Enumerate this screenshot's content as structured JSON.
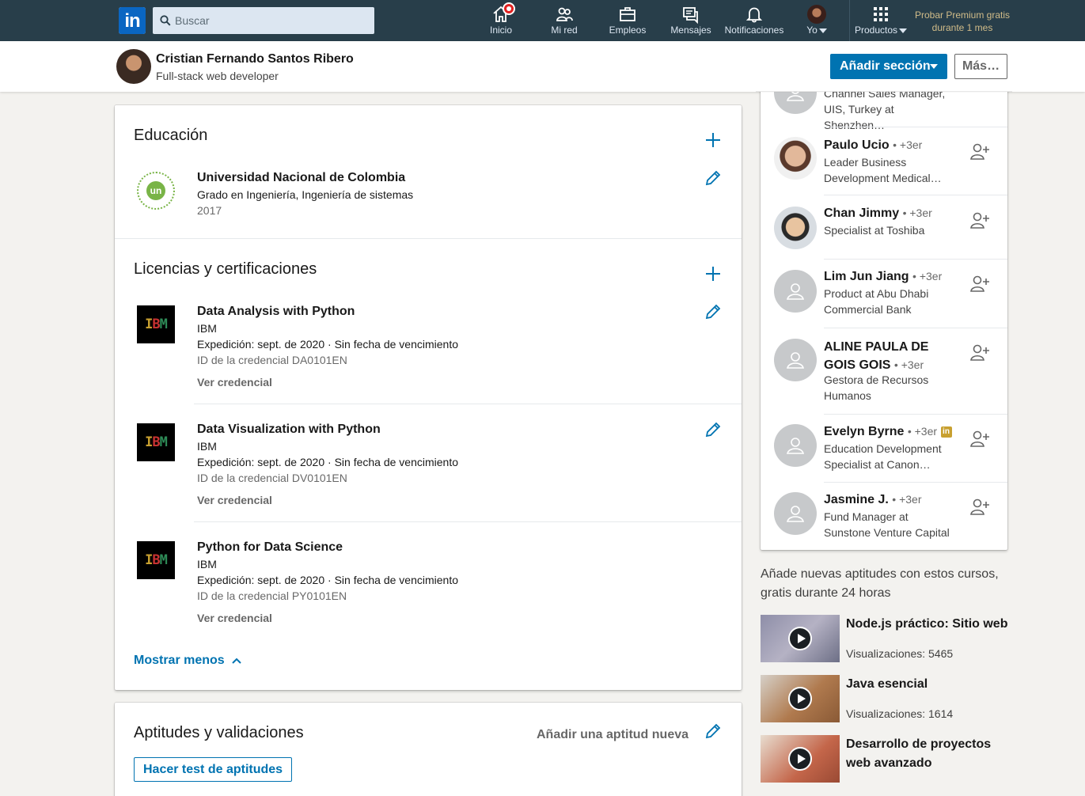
{
  "nav": {
    "logo_text": "in",
    "search_placeholder": "Buscar",
    "items": [
      {
        "label": "Inicio",
        "icon": "home-icon"
      },
      {
        "label": "Mi red",
        "icon": "network-icon"
      },
      {
        "label": "Empleos",
        "icon": "briefcase-icon"
      },
      {
        "label": "Mensajes",
        "icon": "messages-icon"
      },
      {
        "label": "Notificaciones",
        "icon": "bell-icon"
      },
      {
        "label": "Yo",
        "icon": "avatar"
      },
      {
        "label": "Productos",
        "icon": "grid-icon"
      }
    ],
    "premium_line1": "Probar Premium gratis",
    "premium_line2": "durante 1 mes"
  },
  "profile_bar": {
    "name": "Cristian Fernando Santos Ribero",
    "headline": "Full-stack web developer",
    "add_section": "Añadir sección",
    "more": "Más…"
  },
  "education": {
    "title": "Educación",
    "entry": {
      "school": "Universidad Nacional de Colombia",
      "degree": "Grado en Ingeniería, Ingeniería de sistemas",
      "year": "2017",
      "logo_text": "un"
    }
  },
  "licenses": {
    "title": "Licencias y certificaciones",
    "items": [
      {
        "name": "Data Analysis with Python",
        "issuer": "IBM",
        "issued": "Expedición: sept. de 2020",
        "expiry": "Sin fecha de vencimiento",
        "credential": "ID de la credencial DA0101EN",
        "link": "Ver credencial"
      },
      {
        "name": "Data Visualization with Python",
        "issuer": "IBM",
        "issued": "Expedición: sept. de 2020",
        "expiry": "Sin fecha de vencimiento",
        "credential": "ID de la credencial DV0101EN",
        "link": "Ver credencial"
      },
      {
        "name": "Python for Data Science",
        "issuer": "IBM",
        "issued": "Expedición: sept. de 2020",
        "expiry": "Sin fecha de vencimiento",
        "credential": "ID de la credencial PY0101EN",
        "link": "Ver credencial"
      }
    ],
    "show_less": "Mostrar menos",
    "separator": "·"
  },
  "skills": {
    "title": "Aptitudes y validaciones",
    "add_skill": "Añadir una aptitud nueva",
    "test_button": "Hacer test de aptitudes"
  },
  "people": {
    "partial_headline_1": "Channel Sales Manager,",
    "partial_headline_2": "UIS, Turkey at Shenzhen…",
    "items": [
      {
        "name": "Paulo Ucio",
        "degree": "• +3er",
        "headline": "Leader Business Development Medical…"
      },
      {
        "name": "Chan Jimmy",
        "degree": "• +3er",
        "headline": "Specialist at Toshiba"
      },
      {
        "name": "Lim Jun Jiang",
        "degree": "• +3er",
        "headline": "Product at Abu Dhabi Commercial Bank"
      },
      {
        "name_line1": "ALINE PAULA DE",
        "name_line2": "GOIS GOIS",
        "degree": "• +3er",
        "headline": "Gestora de Recursos Humanos"
      },
      {
        "name": "Evelyn Byrne",
        "degree": "• +3er",
        "headline": "Education Development Specialist at Canon…"
      },
      {
        "name": "Jasmine J.",
        "degree": "• +3er",
        "headline": "Fund Manager at Sunstone Venture Capital"
      }
    ]
  },
  "courses": {
    "heading": "Añade nuevas aptitudes con estos cursos, gratis durante 24 horas",
    "items": [
      {
        "title": "Node.js práctico: Sitio web",
        "views": "Visualizaciones: 5465"
      },
      {
        "title": "Java esencial",
        "views": "Visualizaciones: 1614"
      },
      {
        "title": "Desarrollo de proyectos web avanzado",
        "views": ""
      }
    ]
  },
  "colors": {
    "nav_bg": "#283e4a",
    "primary": "#0073b1",
    "premium": "#d1bc89"
  }
}
